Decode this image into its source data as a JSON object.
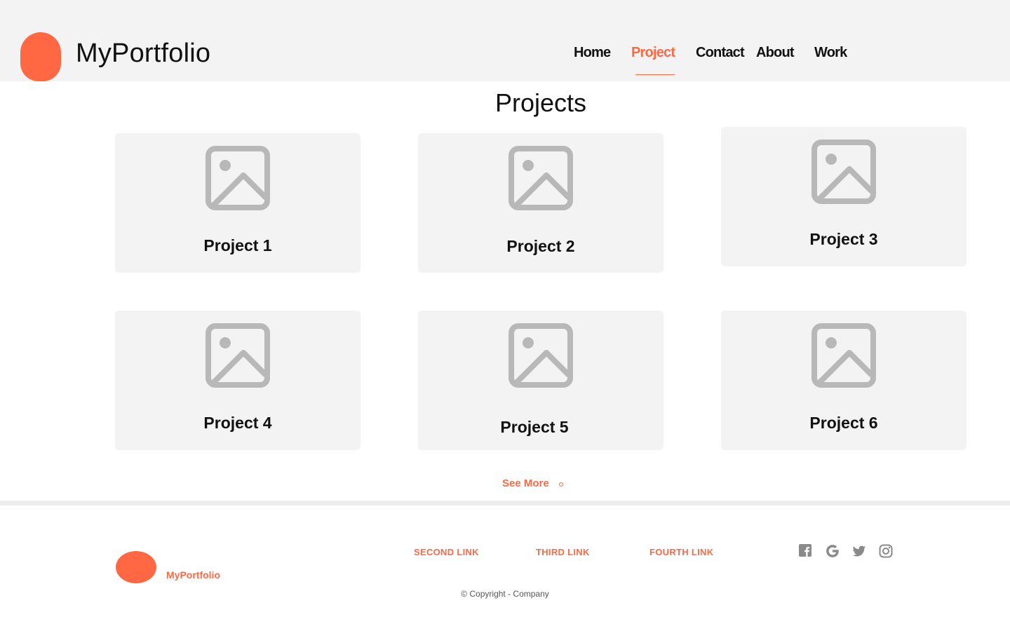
{
  "header": {
    "brand": "MyPortfolio",
    "nav": [
      {
        "label": "Home",
        "active": false
      },
      {
        "label": "Project",
        "active": true
      },
      {
        "label": "Contact",
        "active": false
      },
      {
        "label": "About",
        "active": false
      },
      {
        "label": "Work",
        "active": false
      }
    ]
  },
  "main": {
    "title": "Projects",
    "cards": [
      {
        "title": "Project 1",
        "icon": "image-placeholder-icon"
      },
      {
        "title": "Project 2",
        "icon": "image-placeholder-icon"
      },
      {
        "title": "Project 3",
        "icon": "image-placeholder-icon"
      },
      {
        "title": "Project 4",
        "icon": "image-placeholder-icon"
      },
      {
        "title": "Project 5",
        "icon": "image-placeholder-icon"
      },
      {
        "title": "Project 6",
        "icon": "image-placeholder-icon"
      }
    ],
    "see_more": "See More"
  },
  "footer": {
    "brand": "MyPortfolio",
    "links": [
      "SECOND LINK",
      "THIRD LINK",
      "FOURTH LINK"
    ],
    "social": [
      "facebook-icon",
      "google-icon",
      "twitter-icon",
      "instagram-icon"
    ],
    "copyright": "© Copyright - Company"
  },
  "colors": {
    "accent": "#ff6842",
    "header_bg": "#f3f3f3",
    "card_bg": "#f3f3f3",
    "icon_gray": "#b8b8b8",
    "social_gray": "#8a8a8a"
  }
}
